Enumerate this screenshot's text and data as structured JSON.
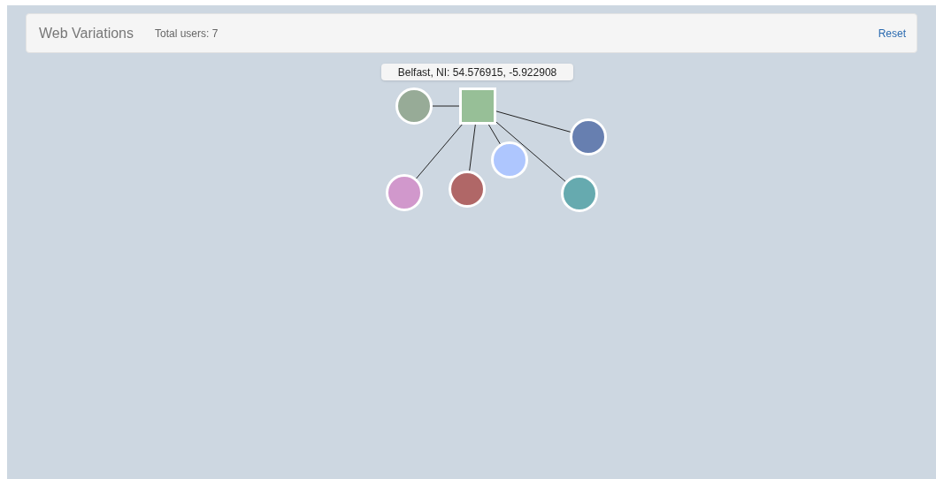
{
  "navbar": {
    "title": "Web Variations",
    "total_users": "Total users: 7",
    "reset": "Reset"
  },
  "graph": {
    "tooltip": "Belfast, NI: 54.576915, -5.922908",
    "nodes": [
      {
        "kind": "square",
        "color": "#97bf97"
      },
      {
        "kind": "circle",
        "color": "#97ab97"
      },
      {
        "kind": "circle",
        "color": "#677fb0"
      },
      {
        "kind": "circle",
        "color": "#aec6fe"
      },
      {
        "kind": "circle",
        "color": "#b06767"
      },
      {
        "kind": "circle",
        "color": "#d198cc"
      },
      {
        "kind": "circle",
        "color": "#66aaaf"
      }
    ]
  }
}
